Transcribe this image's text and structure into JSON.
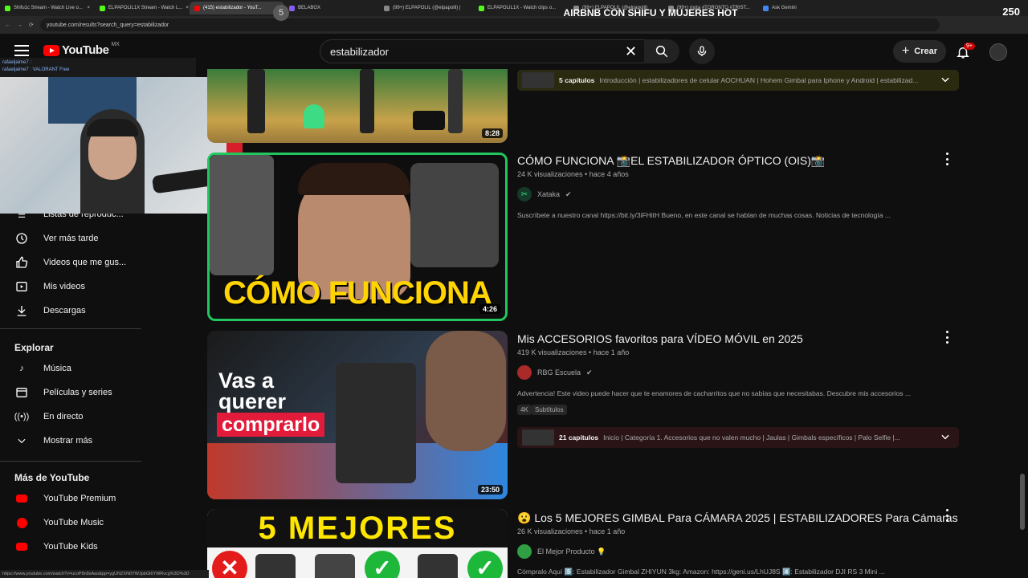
{
  "browser": {
    "tabs": [
      {
        "label": "Shifu1c Stream - Watch Live o...",
        "color": "#53fc18"
      },
      {
        "label": "ELPAPOLIL1X Stream - Watch L...",
        "color": "#53fc18"
      },
      {
        "label": "(415) estabilizador - YouT...",
        "color": "#ff0000"
      },
      {
        "label": "BELABOX",
        "color": "#8a5cf6"
      },
      {
        "label": "(99+) ELPAPOLIL (@elpapolil) |",
        "color": "#888888"
      },
      {
        "label": "ELPAPOLIL1X - Watch clips o...",
        "color": "#53fc18"
      },
      {
        "label": "(99+) ELPAPOLIL (@elpapolil)",
        "color": "#888888"
      },
      {
        "label": "(99+) mota #TORONTO #TRIST...",
        "color": "#888888"
      },
      {
        "label": "Ask Gemini",
        "color": "#4285f4"
      }
    ],
    "url": "youtube.com/results?search_query=estabilizador",
    "status_url": "https://www.youtube.com/watch?v=ucoP8n8sAao&pp=ygUNZXN0YWJpbGl6YWRvcg%3D%3D"
  },
  "stream_overlay": {
    "badge": "5",
    "title": "AIRBNB CON SHIFU Y MUJERES HOT",
    "count": "250",
    "chat": [
      "rafaeljaime7 :",
      "rafaeljaime7 : VALORANT Free"
    ]
  },
  "header": {
    "logo_text": "YouTube",
    "country": "MX",
    "search_value": "estabilizador",
    "create_label": "Crear",
    "notif_badge": "9+"
  },
  "sidebar": {
    "items": [
      {
        "label": "Listas de reproduc...",
        "icon": "playlist-icon"
      },
      {
        "label": "Ver más tarde",
        "icon": "clock-icon"
      },
      {
        "label": "Videos que me gus...",
        "icon": "thumbs-up-icon"
      },
      {
        "label": "Mis videos",
        "icon": "play-square-icon"
      },
      {
        "label": "Descargas",
        "icon": "download-icon"
      }
    ],
    "explore_heading": "Explorar",
    "explore": [
      {
        "label": "Música",
        "icon": "music-icon"
      },
      {
        "label": "Películas y series",
        "icon": "film-icon"
      },
      {
        "label": "En directo",
        "icon": "live-icon"
      },
      {
        "label": "Mostrar más",
        "icon": "chevron-down-icon"
      }
    ],
    "more_heading": "Más de YouTube",
    "more": [
      {
        "label": "YouTube Premium",
        "color": "#ff0000"
      },
      {
        "label": "YouTube Music",
        "color": "#ff0000"
      },
      {
        "label": "YouTube Kids",
        "color": "#ff0000"
      }
    ]
  },
  "videos": [
    {
      "duration": "8:28",
      "chapters": {
        "count": "5 capítulos",
        "text": "Introducción | estabilizadores de celular AOCHUAN | Hohem Gimbal para Iphone y Android | estabilizad..."
      }
    },
    {
      "title": "CÓMO FUNCIONA 📸EL ESTABILIZADOR ÓPTICO (OIS)📸",
      "meta": "24 K visualizaciones • hace 4 años",
      "channel": "Xataka",
      "description": "Suscríbete a nuestro canal https://bit.ly/3iFHitH Bueno, en este canal se hablan de muchas cosas. Noticias de tecnología ...",
      "thumb_text": "CÓMO FUNCIONA",
      "duration": "4:26"
    },
    {
      "title": "Mis ACCESORIOS favoritos para VÍDEO MÓVIL en 2025",
      "meta": "419 K visualizaciones • hace 1 año",
      "channel": "RBG Escuela",
      "description": "Advertencia! Este video puede hacer que te enamores de cacharritos que no sabías que necesitabas. Descubre mis accesorios ...",
      "tags": [
        "4K",
        "Subtítulos"
      ],
      "thumb_lines": [
        "Vas a",
        "querer",
        "comprarlo"
      ],
      "duration": "23:50",
      "chapters": {
        "count": "21 capítulos",
        "text": "Inicio | Categoría 1. Accesorios que no valen mucho | Jaulas | Gimbals específicos | Palo Selfie |..."
      }
    },
    {
      "title": "😮 Los 5 MEJORES GIMBAL Para CÁMARA 2025 | ESTABILIZADORES Para Cámaras",
      "meta": "26 K visualizaciones • hace 1 año",
      "channel": "El Mejor Producto 💡",
      "description": "Cómpralo Aquí 5️⃣: Estabilizador Gimbal ZHIYUN 3kg: Amazon: https://geni.us/LhUJ8S 4️⃣: Estabilizador DJI RS 3 Mini ...",
      "thumb_text": "5 MEJORES"
    }
  ],
  "colors": {
    "accent": "#ff0000",
    "bg": "#0f0f0f",
    "chapter_bg": "#2a2a10",
    "chapter_bg2": "#2a1416"
  }
}
